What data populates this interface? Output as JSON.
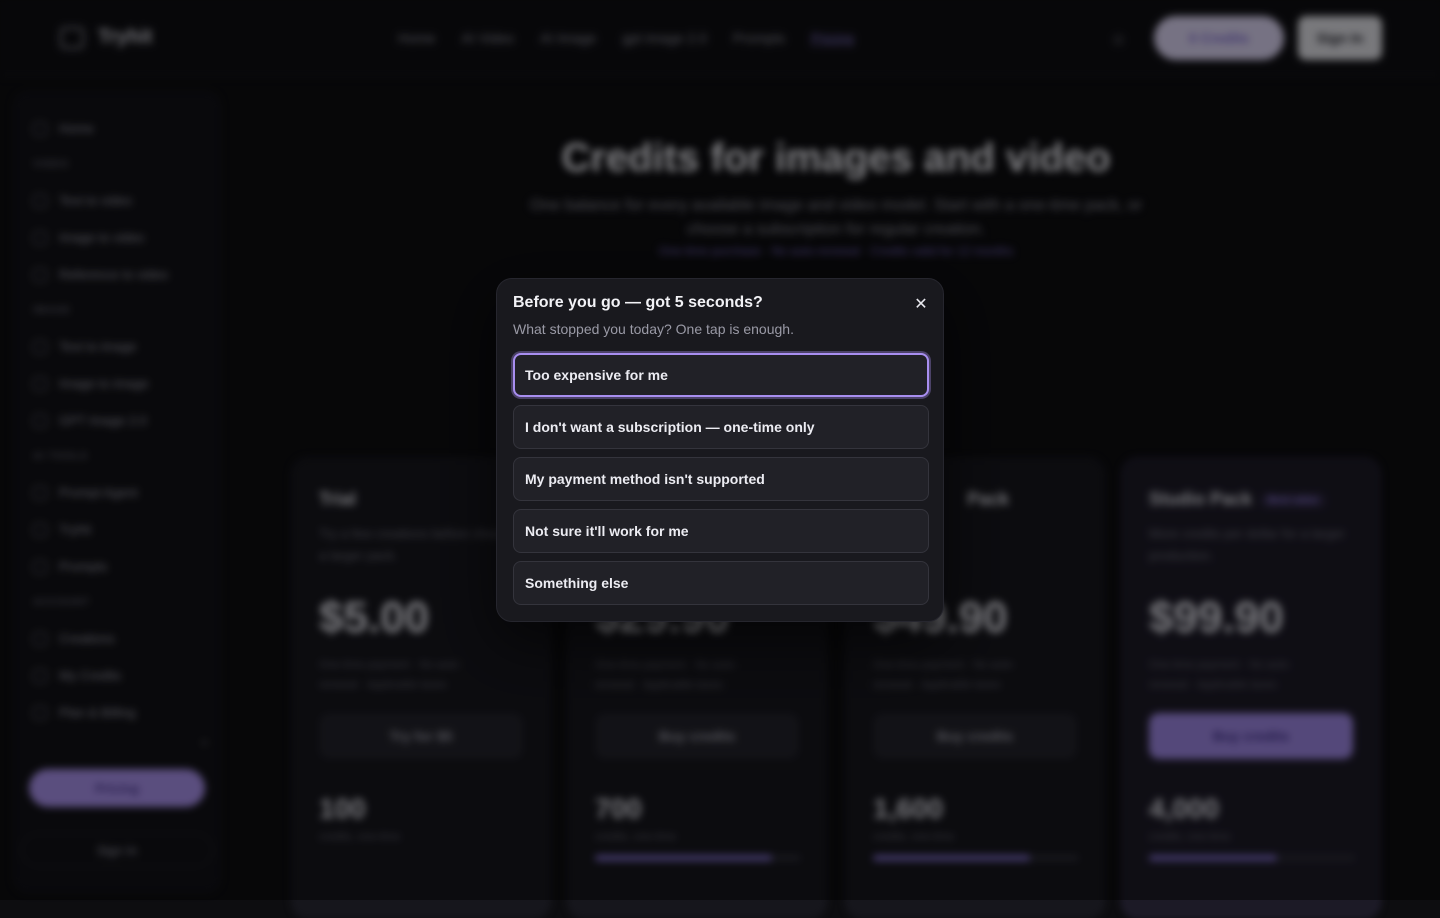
{
  "header": {
    "logo": "Tryhit",
    "nav": [
      "Home",
      "AI Video",
      "AI Image",
      "gpt image 2.0",
      "Prompts",
      "Pricing"
    ],
    "credits_label": "0 Credits",
    "signin_label": "Sign In"
  },
  "sidebar": {
    "home": "Home",
    "sections": [
      {
        "title": "VIDEO",
        "items": [
          "Text to video",
          "Image to video",
          "Reference to video"
        ]
      },
      {
        "title": "IMAGE",
        "items": [
          "Text to image",
          "Image to image",
          "GPT Image 2.0"
        ]
      },
      {
        "title": "AI TOOLS",
        "items": [
          "Prompt Agent",
          "Tryhit",
          "Prompts"
        ]
      },
      {
        "title": "ACCOUNT",
        "items": [
          "Creations",
          "My Credits",
          "Plan & Billing"
        ]
      }
    ],
    "pricing_label": "Pricing",
    "signin_label": "Sign In"
  },
  "hero": {
    "title": "Credits for images and video",
    "subtitle": "One balance for every available image and video model. Start with a one-time pack, or choose a subscription for regular creation.",
    "note": "One-time purchase · No auto-renewal · Credits valid for 12 months"
  },
  "cards": [
    {
      "title": "Trial",
      "badge": "",
      "desc": "Try a few creations before choosing a larger pack.",
      "price": "$5.00",
      "terms": "One-time payment · No auto-renewal · Applicable taxes",
      "button": "Try for $5",
      "credits": "100",
      "credits_label": "credits, one-time",
      "bar": 0
    },
    {
      "title": "",
      "badge": "",
      "desc": "",
      "price": "$29.90",
      "terms": "One-time payment · No auto-renewal · Applicable taxes",
      "button": "Buy credits",
      "credits": "700",
      "credits_label": "credits, one-time",
      "bar": 0.86
    },
    {
      "title": "Pack",
      "badge": "",
      "desc": "",
      "price": "$49.90",
      "terms": "One-time payment · No auto-renewal · Applicable taxes",
      "button": "Buy credits",
      "credits": "1,600",
      "credits_label": "credits, one-time",
      "bar": 0.76
    },
    {
      "title": "Studio Pack",
      "badge": "Best value",
      "desc": "More credits per dollar for a larger production.",
      "price": "$99.90",
      "terms": "One-time payment · No auto-renewal · Applicable taxes",
      "button": "Buy credits",
      "credits": "4,000",
      "credits_label": "credits, one-time",
      "bar": 0.62
    }
  ],
  "modal": {
    "title": "Before you go — got 5 seconds?",
    "subtitle": "What stopped you today? One tap is enough.",
    "close_icon": "close-icon",
    "options": [
      "Too expensive for me",
      "I don't want a subscription — one-time only",
      "My payment method isn't supported",
      "Not sure it'll work for me",
      "Something else"
    ]
  },
  "colors": {
    "accent": "#a88ef0",
    "modal_bg": "#19191e",
    "option_bg": "#212127"
  }
}
